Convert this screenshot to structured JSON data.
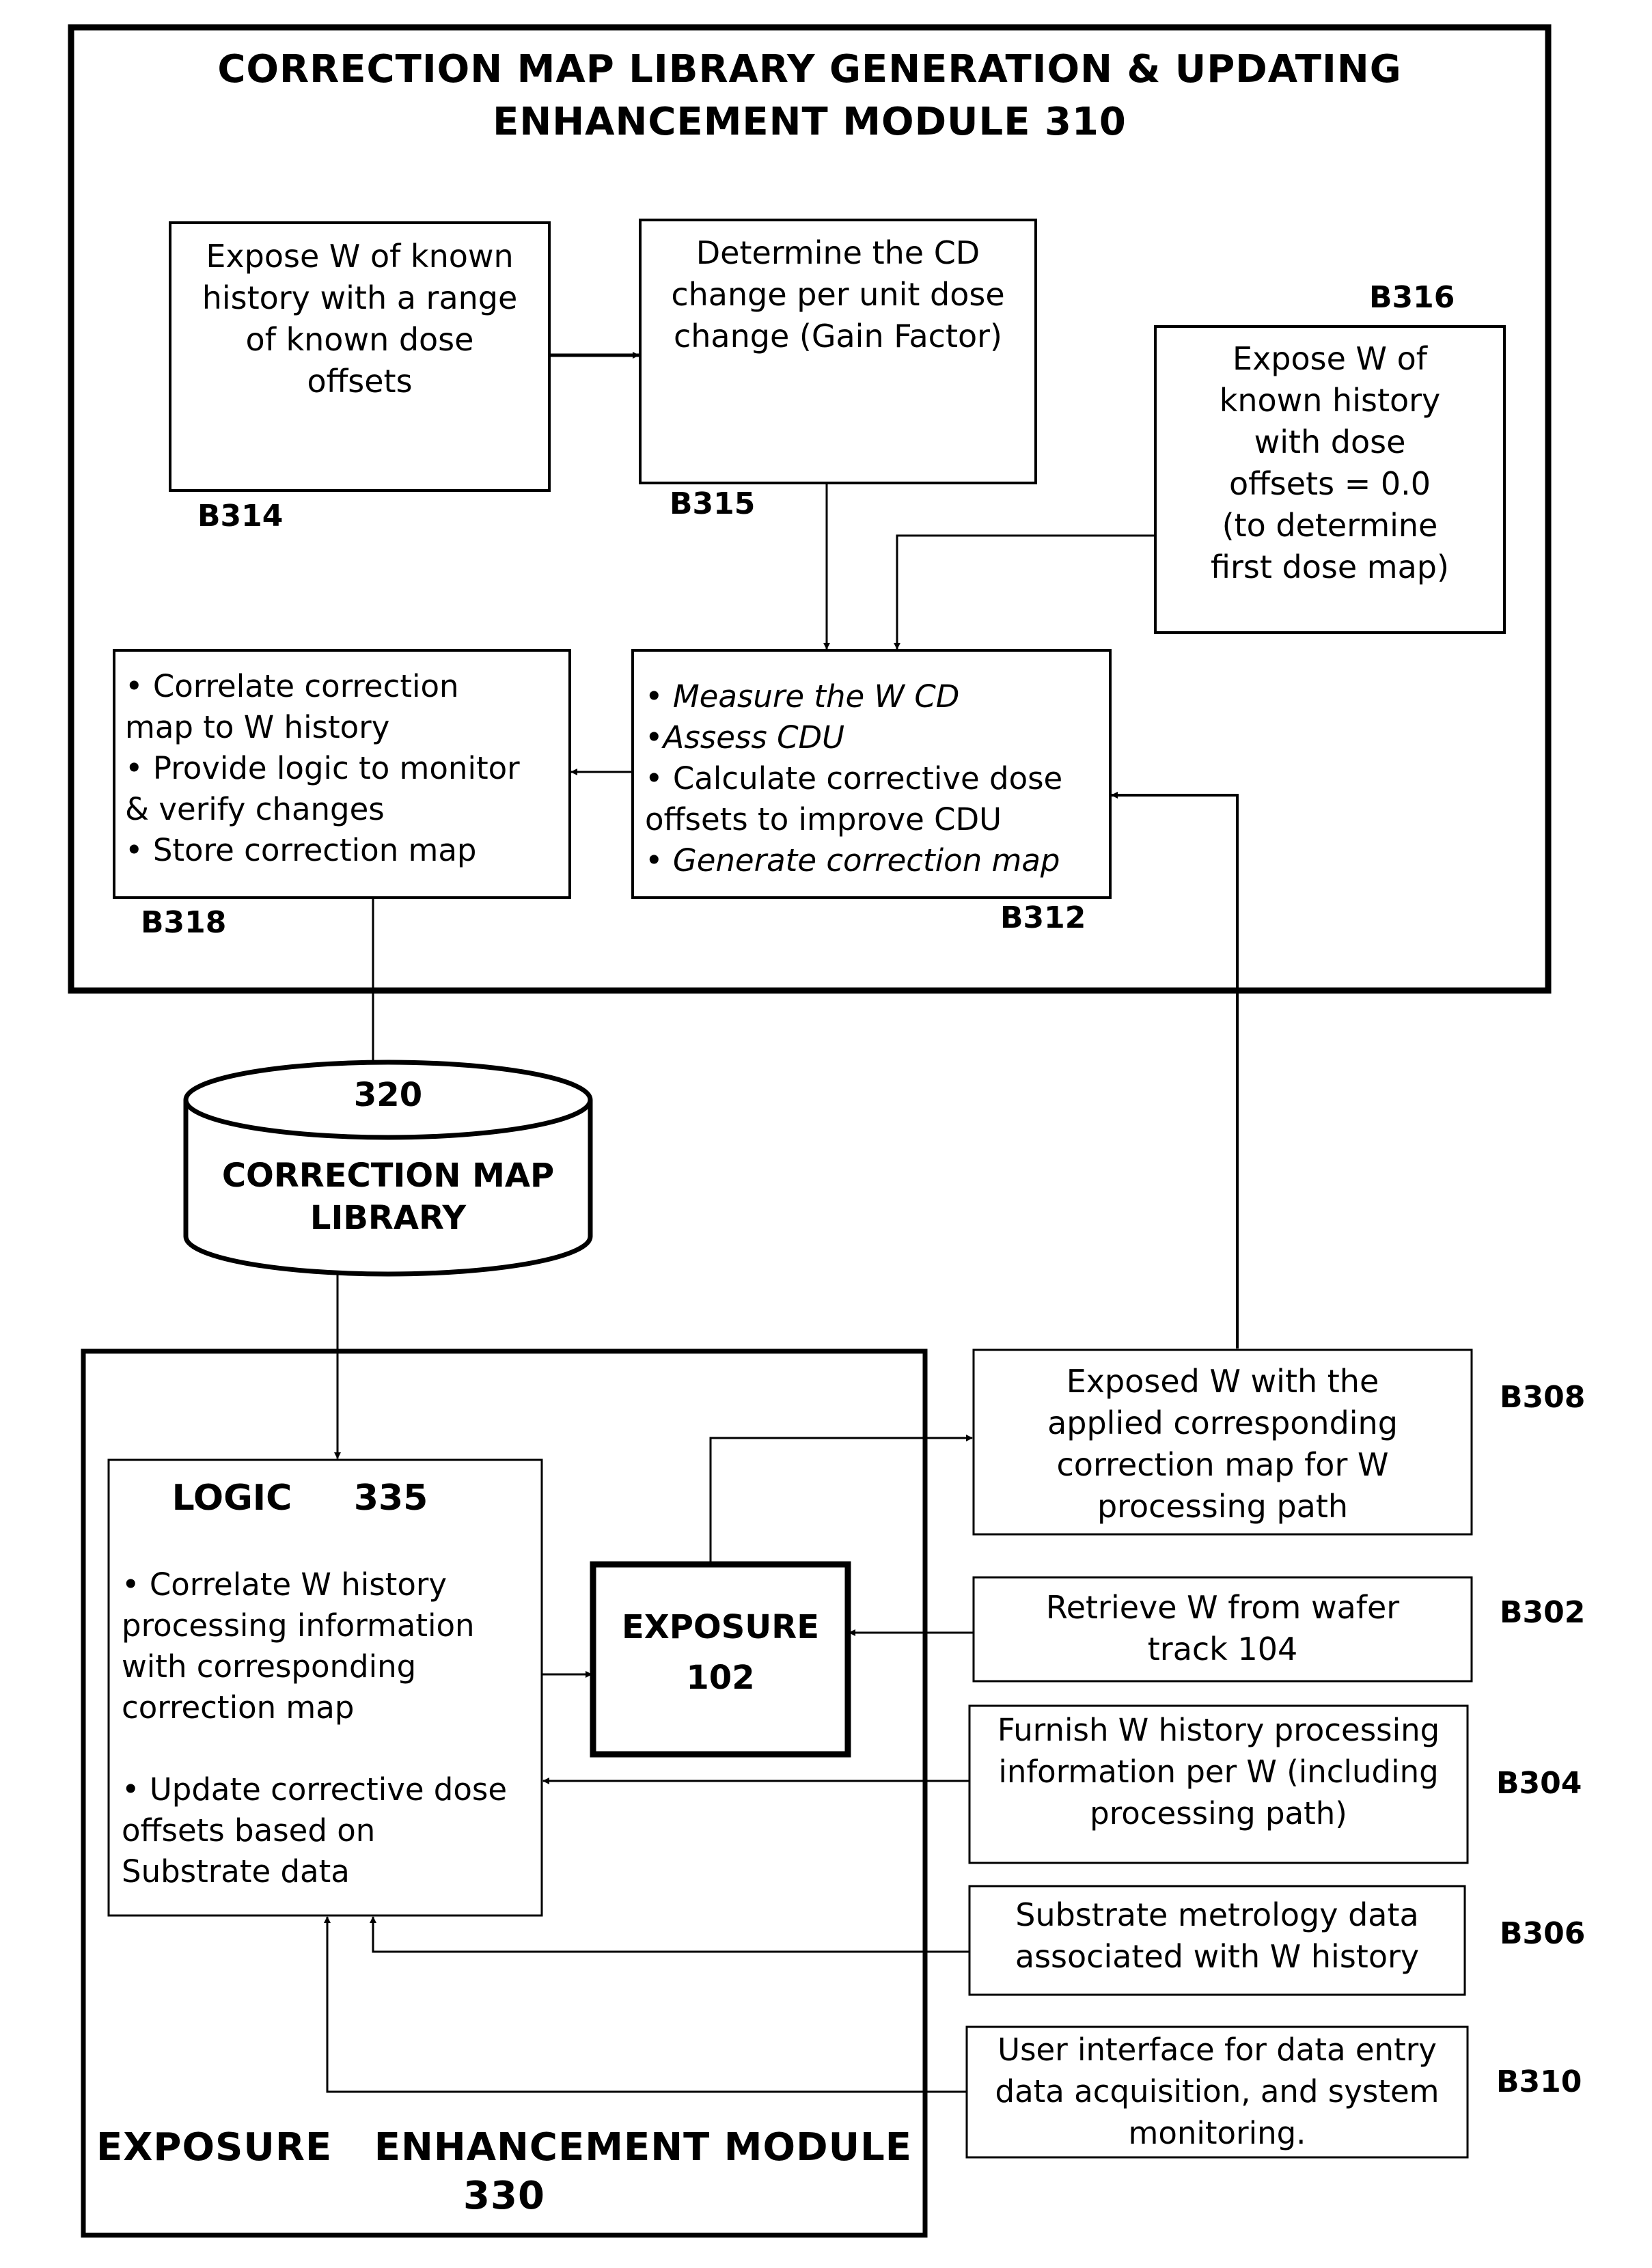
{
  "module_310": {
    "title_line1": "CORRECTION MAP LIBRARY GENERATION & UPDATING",
    "title_line2": "ENHANCEMENT MODULE  310"
  },
  "blocks": {
    "b314": {
      "label": "B314",
      "text": [
        "Expose W of known",
        "history with a range",
        "of known dose",
        "offsets"
      ]
    },
    "b315": {
      "label": "B315",
      "text": [
        "Determine the CD",
        "change per unit dose",
        "change (Gain Factor)"
      ]
    },
    "b316": {
      "label": "B316",
      "text": [
        "Expose W of",
        "known history",
        "with dose",
        "offsets = 0.0",
        "(to determine",
        "first dose map)"
      ]
    },
    "b318": {
      "label": "B318",
      "text": [
        "• Correlate correction",
        "map to W history",
        "• Provide  logic to monitor",
        "& verify changes",
        "• Store correction map"
      ]
    },
    "b312": {
      "label": "B312",
      "text": [
        "• Measure the W   CD",
        "•Assess CDU",
        "• Calculate corrective dose",
        "offsets to improve  CDU",
        "• Generate correction map"
      ]
    },
    "b308": {
      "label": "B308",
      "text": [
        "Exposed W with the",
        "applied corresponding",
        "correction map for W",
        "processing path"
      ]
    },
    "b302": {
      "label": "B302",
      "text": [
        "Retrieve W from wafer",
        "track 104"
      ]
    },
    "b304": {
      "label": "B304",
      "text": [
        "Furnish W history processing",
        "information per W  (including",
        "processing path)"
      ]
    },
    "b306": {
      "label": "B306",
      "text": [
        "Substrate metrology data",
        "associated with W history"
      ]
    },
    "b310": {
      "label": "B310",
      "text": [
        "User interface for data entry",
        "data acquisition, and system",
        "monitoring."
      ]
    }
  },
  "library_320": {
    "number": "320",
    "line1": "CORRECTION MAP",
    "line2": "LIBRARY"
  },
  "module_330": {
    "title_line1": "EXPOSURE   ENHANCEMENT MODULE",
    "title_line2": "330"
  },
  "logic_335": {
    "heading": "LOGIC     335",
    "text": [
      "• Correlate W history",
      "processing information",
      "with corresponding",
      "correction map",
      "",
      "• Update corrective dose",
      "offsets based on",
      "Substrate data"
    ]
  },
  "exposure_102": {
    "line1": "EXPOSURE",
    "line2": "102"
  }
}
